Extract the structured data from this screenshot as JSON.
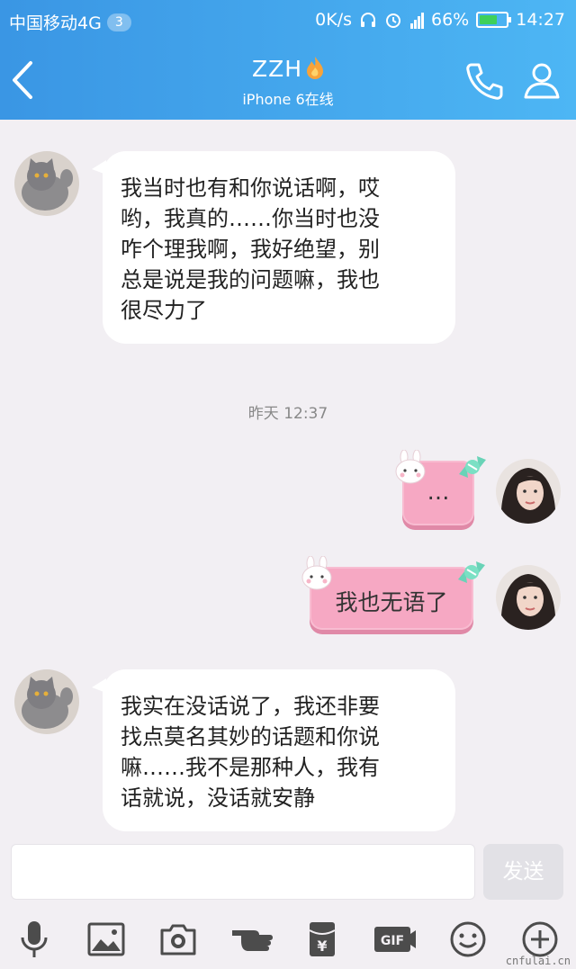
{
  "status_bar": {
    "carrier": "中国移动4G",
    "carrier_badge": "3",
    "speed": "0K/s",
    "battery_percent": "66%",
    "battery_level": 0.66,
    "time": "14:27"
  },
  "header": {
    "contact_name": "ZZH",
    "status": "iPhone 6在线",
    "back_icon": "chevron-left-icon",
    "call_icon": "phone-icon",
    "profile_icon": "person-icon"
  },
  "messages": [
    {
      "side": "left",
      "lines": [
        "我当时也有和你说话啊，哎",
        "哟，我真的……你当时也没",
        "咋个理我啊，我好绝望，别",
        "总是说是我的问题嘛，我也",
        "很尽力了"
      ]
    },
    {
      "side": "right",
      "text": "…"
    },
    {
      "side": "right",
      "text": "我也无语了"
    },
    {
      "side": "left",
      "lines": [
        "我实在没话说了，我还非要",
        "找点莫名其妙的话题和你说",
        "嘛……我不是那种人，我有",
        "话就说，没话就安静"
      ]
    }
  ],
  "timestamp": "昨天  12:37",
  "input": {
    "value": "",
    "send_label": "发送"
  },
  "toolbar": [
    "microphone-icon",
    "image-icon",
    "camera-icon",
    "poke-icon",
    "red-packet-icon",
    "gif-icon",
    "emoji-icon",
    "plus-icon"
  ],
  "watermark": "cnfulai.cn",
  "colors": {
    "header_gradient_start": "#3a96e4",
    "header_gradient_end": "#4db6f4",
    "chat_background": "#f2eff3",
    "right_bubble": "#f6a8c3"
  }
}
